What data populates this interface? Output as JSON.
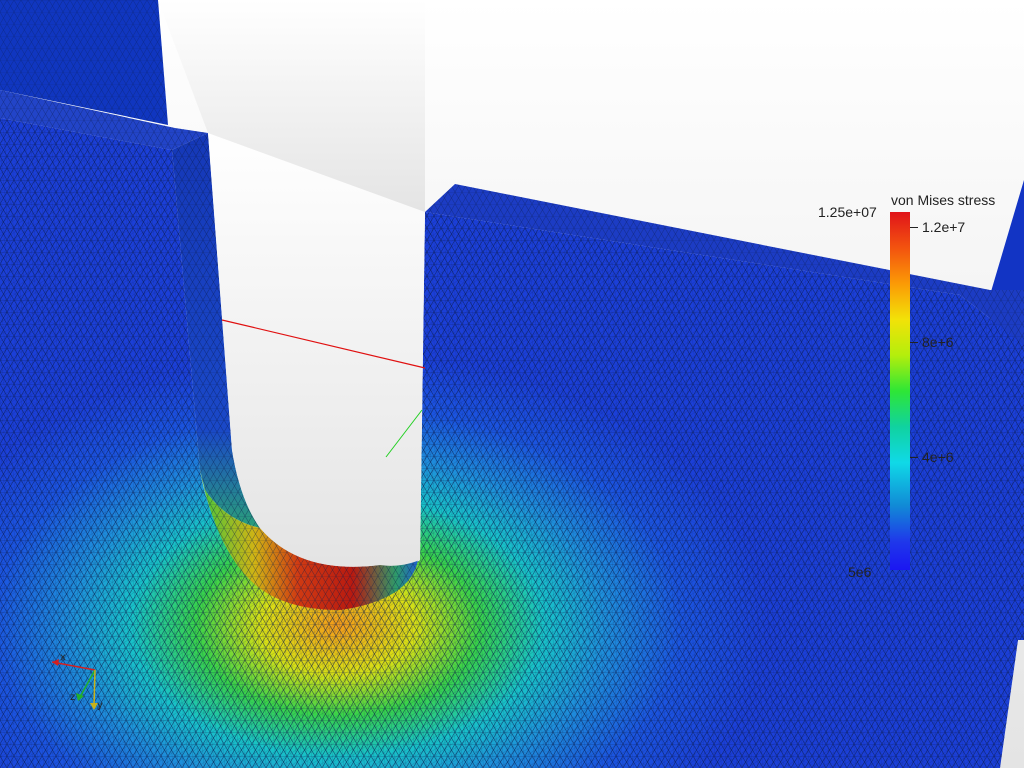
{
  "scene": {
    "background_top": "#ffffff",
    "background_bottom": "#e6e6e6"
  },
  "colorbar": {
    "title": "von Mises stress",
    "max_label": "1.25e+07",
    "min_label": "5e6",
    "ticks": [
      {
        "label": "1.2e+7",
        "value": 12000000
      },
      {
        "label": "8e+6",
        "value": 8000000
      },
      {
        "label": "4e+6",
        "value": 4000000
      }
    ],
    "colormap": [
      "#1b16f2",
      "#118ad6",
      "#10d9e7",
      "#2ee636",
      "#f2e208",
      "#fb9a06",
      "#e0141a"
    ]
  },
  "orientation_axes": {
    "x_label": "x",
    "y_label": "y",
    "z_label": "z",
    "x_color": "#d42020",
    "y_color": "#c8b21a",
    "z_color": "#22b02a"
  },
  "part_color": "#1b3fd8"
}
